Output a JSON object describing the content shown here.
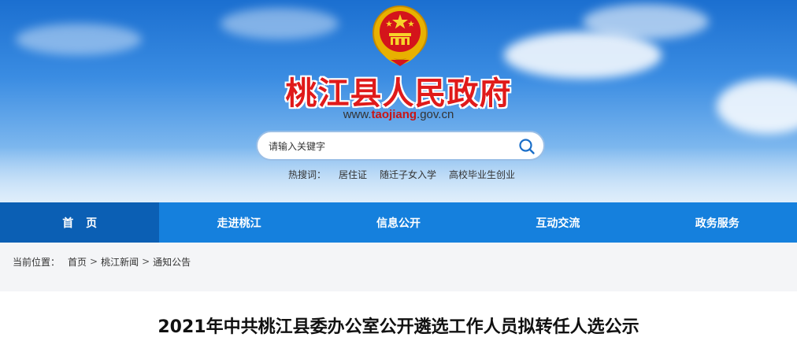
{
  "header": {
    "site_title": "桃江县人民政府",
    "url_prefix": "www.",
    "url_domain": "taojiang",
    "url_suffix": ".gov.cn",
    "emblem_icon": "national-emblem-icon"
  },
  "search": {
    "placeholder": "请输入关键字",
    "icon": "search-icon"
  },
  "hot_search": {
    "label": "热搜词：",
    "items": [
      "居住证",
      "随迁子女入学",
      "高校毕业生创业"
    ]
  },
  "nav": {
    "items": [
      "首页",
      "走进桃江",
      "信息公开",
      "互动交流",
      "政务服务"
    ],
    "active_index": 0
  },
  "breadcrumb": {
    "label": "当前位置：",
    "items": [
      "首页",
      "桃江新闻",
      "通知公告"
    ],
    "separator": ">"
  },
  "article": {
    "title": "2021年中共桃江县委办公室公开遴选工作人员拟转任人选公示"
  },
  "colors": {
    "nav_bg": "#1580dd",
    "nav_active": "#0b5fb4",
    "title_red": "#e01a1a"
  }
}
